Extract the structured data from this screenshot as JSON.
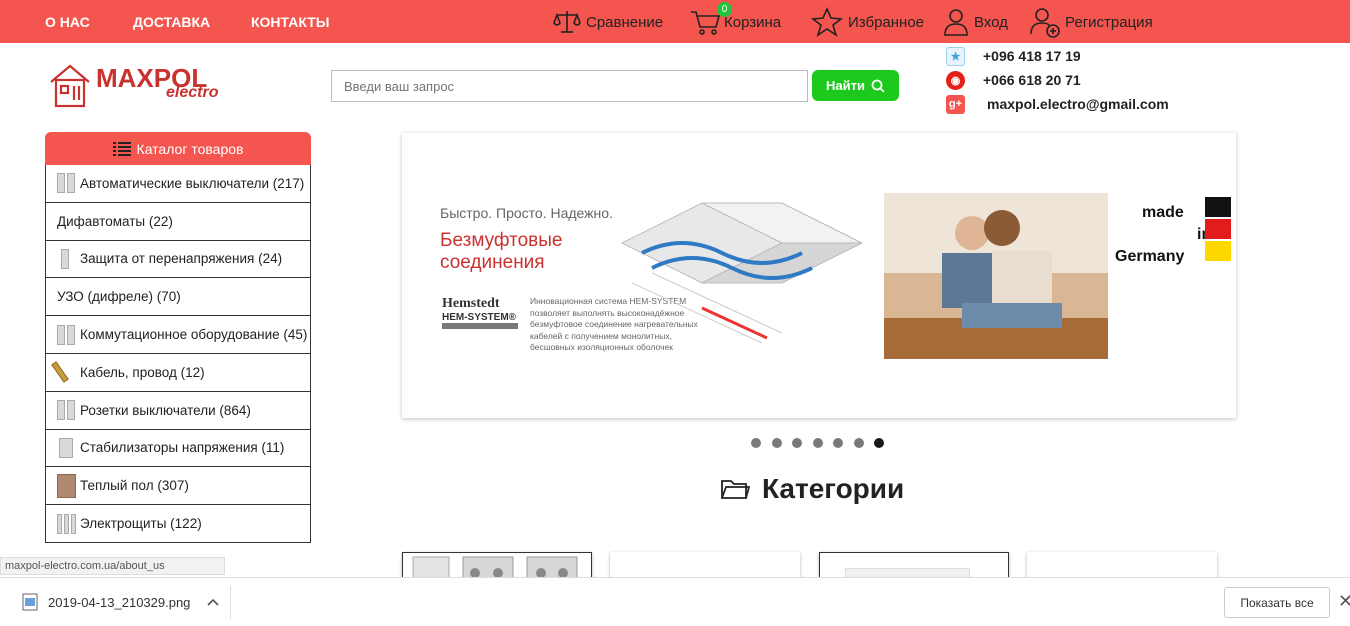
{
  "topnav": {
    "links": [
      "О НАС",
      "ДОСТАВКА",
      "КОНТАКТЫ"
    ],
    "compare_label": "Сравнение",
    "cart_label": "Корзина",
    "cart_count": "0",
    "favorites_label": "Избранное",
    "login_label": "Вход",
    "register_label": "Регистрация"
  },
  "logo": {
    "brand": "MAXPOL",
    "sub": "electro"
  },
  "search": {
    "placeholder": "Введи ваш запрос",
    "button_label": "Найти"
  },
  "contacts": {
    "phone1": "+096 418 17 19",
    "phone2": "+066 618 20 71",
    "email": "maxpol.electro@gmail.com"
  },
  "catalog": {
    "title": "Каталог товаров",
    "items": [
      "Автоматические выключатели (217)",
      "Дифавтоматы (22)",
      "Защита от перенапряжения (24)",
      "УЗО (дифреле) (70)",
      "Коммутационное оборудование (45)",
      "Кабель, провод (12)",
      "Розетки выключатели (864)",
      "Стабилизаторы напряжения (11)",
      "Теплый пол (307)",
      "Электрощиты (122)"
    ]
  },
  "banner": {
    "tagline": "Быстро. Просто. Надежно.",
    "headline1": "Безмуфтовые",
    "headline2": "соединения",
    "brand": "Hemstedt",
    "brand_sub": "HEM-SYSTEM®",
    "description": "Инновационная система HEM-SYSTEM позволяет выполнять высоконадёжное безмуфтовое соединение нагревательных кабелей с получением монолитных, бесшовных изоляционных оболочек",
    "made1": "made",
    "made2": "in",
    "made3": "Germany"
  },
  "slider": {
    "dot_count": 7,
    "active_dot": 6
  },
  "categories_title": "Категории",
  "status_url": "maxpol-electro.com.ua/about_us",
  "download": {
    "filename": "2019-04-13_210329.png",
    "show_all": "Показать все"
  },
  "colors": {
    "accent": "#f4554e",
    "search_button": "#1ec91e",
    "logo": "#c8322f"
  }
}
